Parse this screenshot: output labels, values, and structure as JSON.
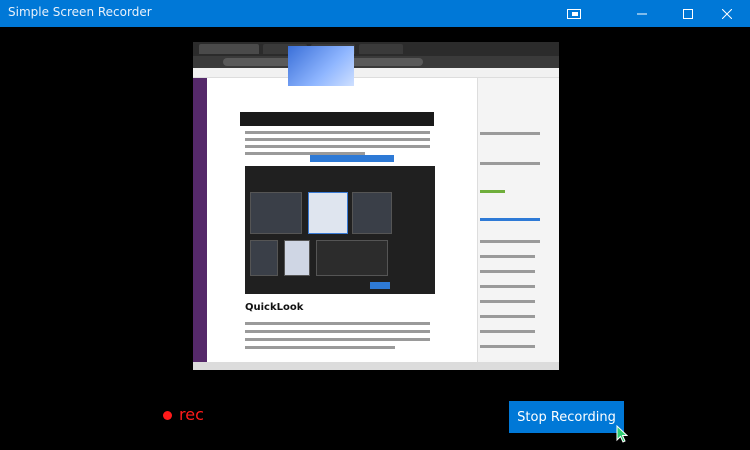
{
  "window": {
    "title": "Simple Screen Recorder",
    "controls": [
      "restore-tab-icon",
      "minimize-icon",
      "maximize-icon",
      "close-icon"
    ]
  },
  "preview": {
    "section_heading": "QuickLook"
  },
  "status": {
    "label": "rec",
    "color": "#ff1a1a"
  },
  "actions": {
    "stop_label": "Stop Recording",
    "accent": "#0078d7"
  }
}
